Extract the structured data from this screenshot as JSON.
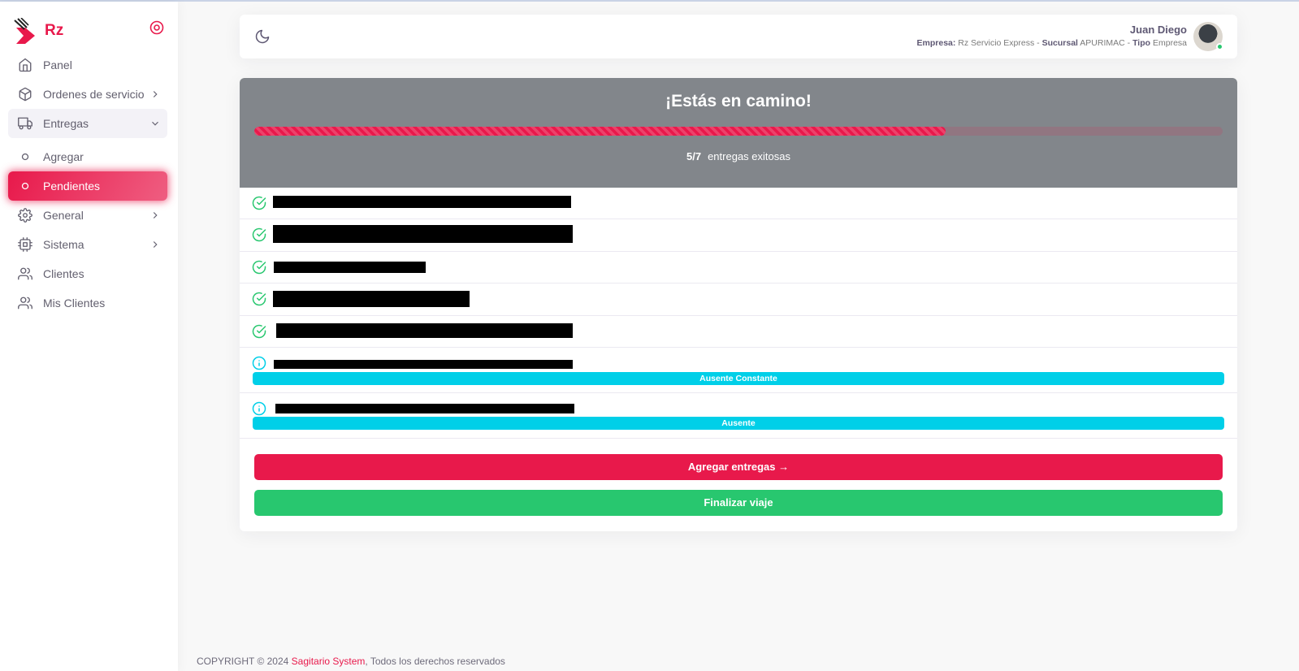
{
  "brand": {
    "name": "Rz"
  },
  "sidebar": {
    "items": [
      {
        "label": "Panel",
        "icon": "home-icon"
      },
      {
        "label": "Ordenes de servicio",
        "icon": "box-icon",
        "chevron": "chevron-right-icon"
      },
      {
        "label": "Entregas",
        "icon": "truck-icon",
        "chevron": "chevron-down-icon",
        "open": true
      },
      {
        "label": "Agregar",
        "icon": "circle-icon",
        "sub": true
      },
      {
        "label": "Pendientes",
        "icon": "circle-icon",
        "sub": true,
        "active": true
      },
      {
        "label": "General",
        "icon": "settings-icon",
        "chevron": "chevron-right-icon"
      },
      {
        "label": "Sistema",
        "icon": "cpu-icon",
        "chevron": "chevron-right-icon"
      },
      {
        "label": "Clientes",
        "icon": "users-icon"
      },
      {
        "label": "Mis Clientes",
        "icon": "users-icon"
      }
    ]
  },
  "navbar": {
    "user_name": "Juan Diego",
    "empresa_label": "Empresa:",
    "empresa_value": "Rz Servicio Express",
    "sucursal_label": "Sucursal",
    "sucursal_value": "APURIMAC",
    "tipo_label": "Tipo",
    "tipo_value": "Empresa",
    "separator": " - "
  },
  "trip": {
    "title": "¡Estás en camino!",
    "completed": 5,
    "total": 7,
    "count_text": "5/7",
    "count_label": "entregas exitosas",
    "progress_fraction": 0.714
  },
  "deliveries": [
    {
      "status": "success",
      "icon": "check-circle-icon"
    },
    {
      "status": "success",
      "icon": "check-circle-icon"
    },
    {
      "status": "success",
      "icon": "check-circle-icon"
    },
    {
      "status": "success",
      "icon": "check-circle-icon"
    },
    {
      "status": "success",
      "icon": "check-circle-icon"
    },
    {
      "status": "info",
      "icon": "info-icon",
      "badge": "Ausente Constante"
    },
    {
      "status": "info",
      "icon": "info-icon",
      "badge": "Ausente"
    }
  ],
  "actions": {
    "add_label": "Agregar entregas →",
    "finish_label": "Finalizar viaje"
  },
  "footer": {
    "prefix": "COPYRIGHT © 2024 ",
    "brand": "Sagitario System",
    "suffix": ", Todos los derechos reservados"
  },
  "colors": {
    "primary": "#e8194b",
    "success": "#28c76f",
    "info": "#00cfe8",
    "header_gray": "#82868b"
  }
}
